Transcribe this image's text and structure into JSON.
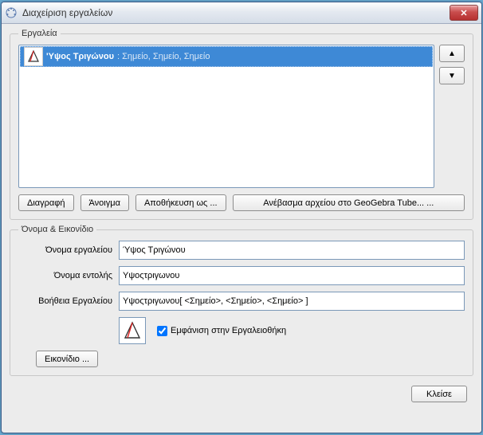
{
  "window_title": "Διαχείριση εργαλείων",
  "close_label": "✕",
  "tools": {
    "legend": "Εργαλεία",
    "items": [
      {
        "name": "'Υψος Τριγώνου",
        "desc": ": Σημείο, Σημείο, Σημείο"
      }
    ],
    "up_arrow": "▲",
    "down_arrow": "▼",
    "delete": "Διαγραφή",
    "open": "Άνοιγμα",
    "save_as": "Αποθήκευση ως ...",
    "upload": "Ανέβασμα αρχείου στο GeoGebra Tube... ..."
  },
  "details": {
    "legend": "Όνομα & Εικονίδιο",
    "tool_name_label": "Όνομα εργαλείου",
    "tool_name_value": "Ύψος Τριγώνου",
    "command_label": "Όνομα εντολής",
    "command_value": "Υψοςτριγωνου",
    "help_label": "Βοήθεια Εργαλείου",
    "help_value": "Υψοςτριγωνου[ <Σημείο>, <Σημείο>, <Σημείο> ]",
    "show_in_toolbar": "Εμφάνιση στην Εργαλειοθήκη",
    "icon_button": "Εικονίδιο ..."
  },
  "close_button": "Κλείσε"
}
